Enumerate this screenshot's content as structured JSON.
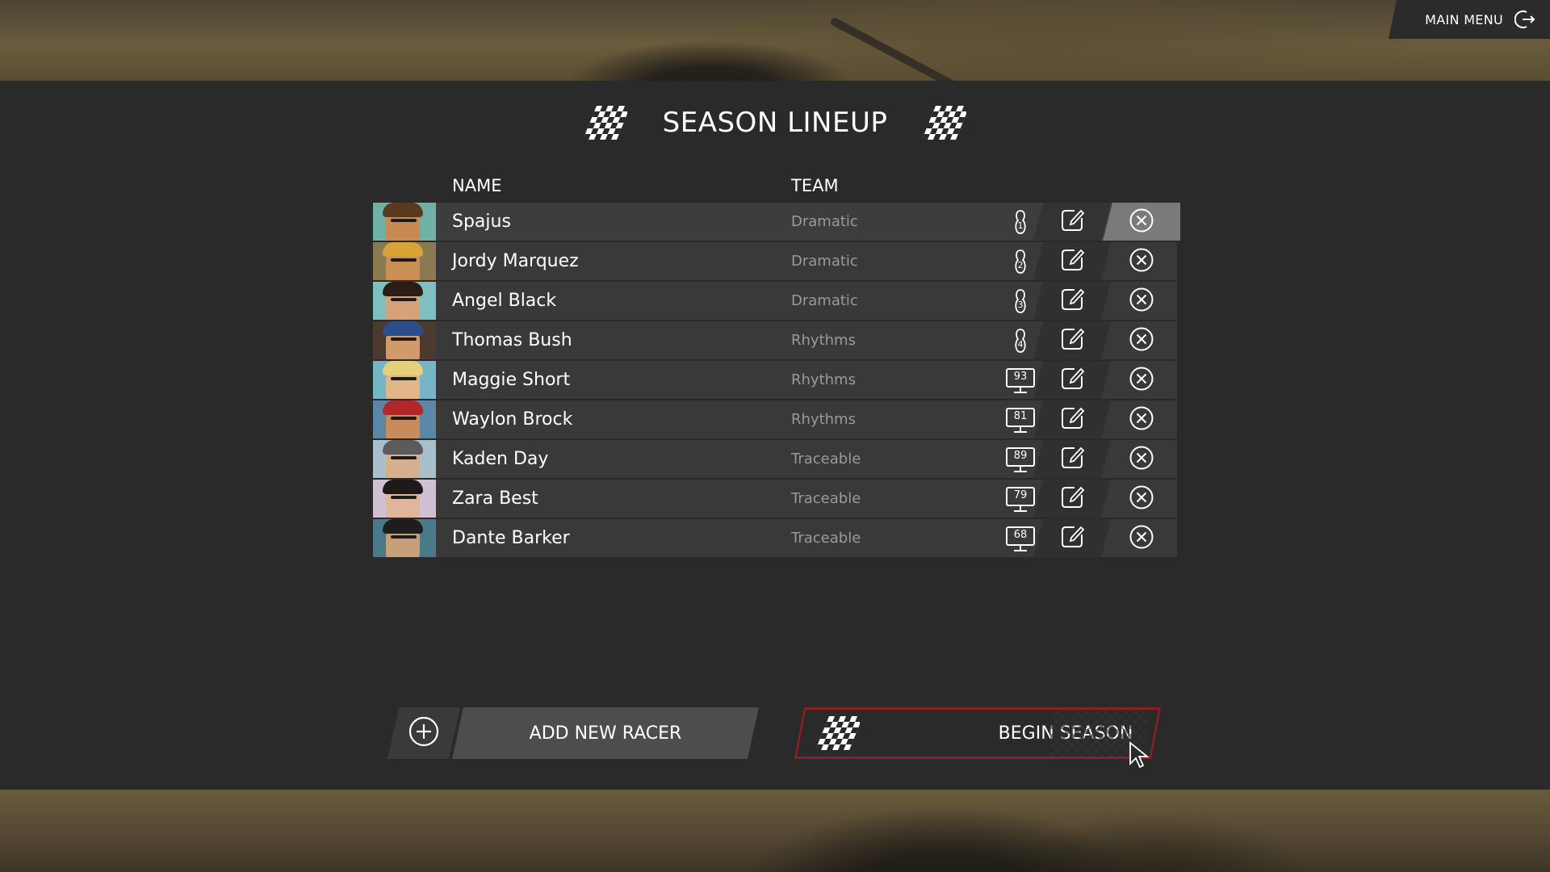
{
  "header": {
    "main_menu_label": "MAIN MENU",
    "title": "SEASON LINEUP"
  },
  "table": {
    "columns": {
      "name": "NAME",
      "team": "TEAM"
    },
    "racers": [
      {
        "name": "Spajus",
        "team": "Dramatic",
        "control": "controller",
        "control_value": "1",
        "avatar_bg": "#6fb2a5",
        "skin": "#c98a52",
        "hair": "#5a3a1e"
      },
      {
        "name": "Jordy Marquez",
        "team": "Dramatic",
        "control": "controller",
        "control_value": "2",
        "avatar_bg": "#8a7a52",
        "skin": "#c98f55",
        "hair": "#d8a43a"
      },
      {
        "name": "Angel Black",
        "team": "Dramatic",
        "control": "controller",
        "control_value": "3",
        "avatar_bg": "#7ec0c2",
        "skin": "#d6a27a",
        "hair": "#2b1d14"
      },
      {
        "name": "Thomas Bush",
        "team": "Rhythms",
        "control": "controller",
        "control_value": "4",
        "avatar_bg": "#4c3a2e",
        "skin": "#d09a6a",
        "hair": "#2c4c8a"
      },
      {
        "name": "Maggie Short",
        "team": "Rhythms",
        "control": "ai",
        "control_value": "93",
        "avatar_bg": "#74b6c8",
        "skin": "#e2b688",
        "hair": "#e6cf7a"
      },
      {
        "name": "Waylon Brock",
        "team": "Rhythms",
        "control": "ai",
        "control_value": "81",
        "avatar_bg": "#5a87a6",
        "skin": "#c98a5c",
        "hair": "#b3272b"
      },
      {
        "name": "Kaden Day",
        "team": "Traceable",
        "control": "ai",
        "control_value": "89",
        "avatar_bg": "#a8c0cc",
        "skin": "#d6b08c",
        "hair": "#5b5b5b"
      },
      {
        "name": "Zara Best",
        "team": "Traceable",
        "control": "ai",
        "control_value": "79",
        "avatar_bg": "#cfc0d4",
        "skin": "#e0b59a",
        "hair": "#1f1a1a"
      },
      {
        "name": "Dante Barker",
        "team": "Traceable",
        "control": "ai",
        "control_value": "68",
        "avatar_bg": "#4a7a8a",
        "skin": "#c7a07a",
        "hair": "#1d1d1d"
      }
    ]
  },
  "actions": {
    "add_racer_label": "ADD NEW RACER",
    "begin_season_label": "BEGIN SEASON"
  },
  "colors": {
    "panel": "#2a2a2a",
    "row": "#393939",
    "team_text": "#9a9a9a",
    "begin_border": "#8c1f24",
    "remove_highlight": "#7a7a7a"
  }
}
